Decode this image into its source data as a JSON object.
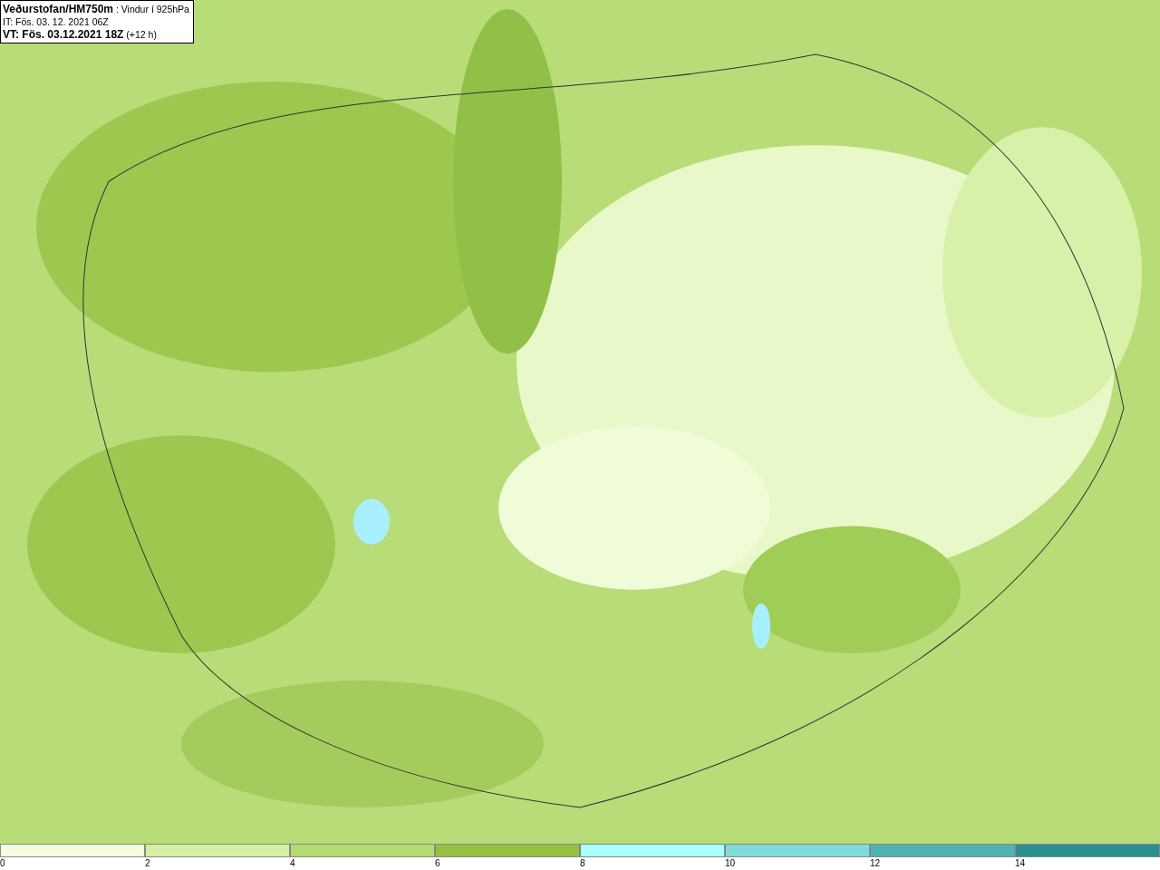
{
  "title_box": {
    "lines": [
      "**Veðurstofan/HM750m** : Vindur í 925hPa",
      "IT: Fös. 03. 12. 2021 06Z",
      "**VT: Fös. 03.12.2021 18Z** (+12 h)"
    ]
  },
  "legend": {
    "bins": [
      {
        "color": "#f5fde0"
      },
      {
        "color": "#d4f0a0"
      },
      {
        "color": "#b4dc70"
      },
      {
        "color": "#96c040"
      },
      {
        "color": "#aaffff"
      },
      {
        "color": "#80dcdc"
      },
      {
        "color": "#50b4b4"
      },
      {
        "color": "#289090"
      }
    ],
    "ticks": [
      "0",
      "2",
      "4",
      "6",
      "8",
      "10",
      "12",
      "14"
    ]
  }
}
